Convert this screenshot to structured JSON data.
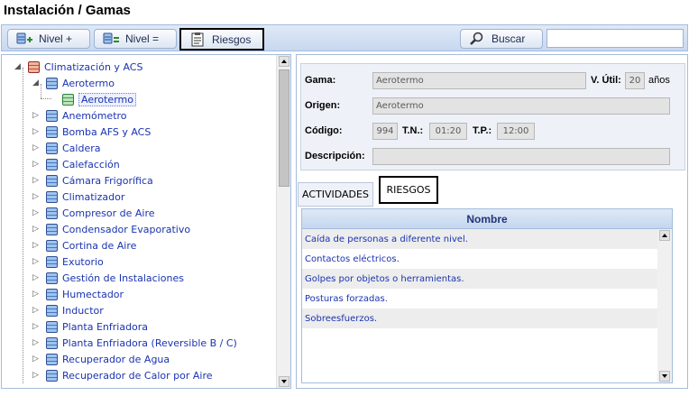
{
  "page": {
    "title": "Instalación / Gamas"
  },
  "toolbar": {
    "nivel_mas": "Nivel +",
    "nivel_igual": "Nivel =",
    "riesgos": "Riesgos",
    "buscar": "Buscar",
    "search_value": ""
  },
  "tree": {
    "root": "Climatización y ACS",
    "expanded": "Aerotermo",
    "child": "Aerotermo",
    "items": [
      "Anemómetro",
      "Bomba AFS y ACS",
      "Caldera",
      "Calefacción",
      "Cámara Frigorífica",
      "Climatizador",
      "Compresor de Aire",
      "Condensador Evaporativo",
      "Cortina de Aire",
      "Exutorio",
      "Gestión de Instalaciones",
      "Humectador",
      "Inductor",
      "Planta Enfriadora",
      "Planta Enfriadora (Reversible B / C)",
      "Recuperador de Agua",
      "Recuperador de Calor por Aire"
    ]
  },
  "form": {
    "gama_label": "Gama:",
    "gama_value": "Aerotermo",
    "vutil_label": "V. Útil:",
    "vutil_value": "20",
    "vutil_unit": "años",
    "origen_label": "Origen:",
    "origen_value": "Aerotermo",
    "codigo_label": "Código:",
    "codigo_value": "994",
    "tn_label": "T.N.:",
    "tn_value": "01:20",
    "tp_label": "T.P.:",
    "tp_value": "12:00",
    "descripcion_label": "Descripción:",
    "descripcion_value": ""
  },
  "tabs": {
    "actividades": "ACTIVIDADES",
    "riesgos": "RIESGOS"
  },
  "grid": {
    "header": "Nombre",
    "rows": [
      "Caída de personas a diferente nivel.",
      "Contactos eléctricos.",
      "Golpes por objetos o herramientas.",
      "Posturas forzadas.",
      "Sobreesfuerzos."
    ]
  },
  "colors": {
    "accent": "#1a33b0",
    "toolbar": "#c7d8ef",
    "border": "#a5bcdc"
  }
}
